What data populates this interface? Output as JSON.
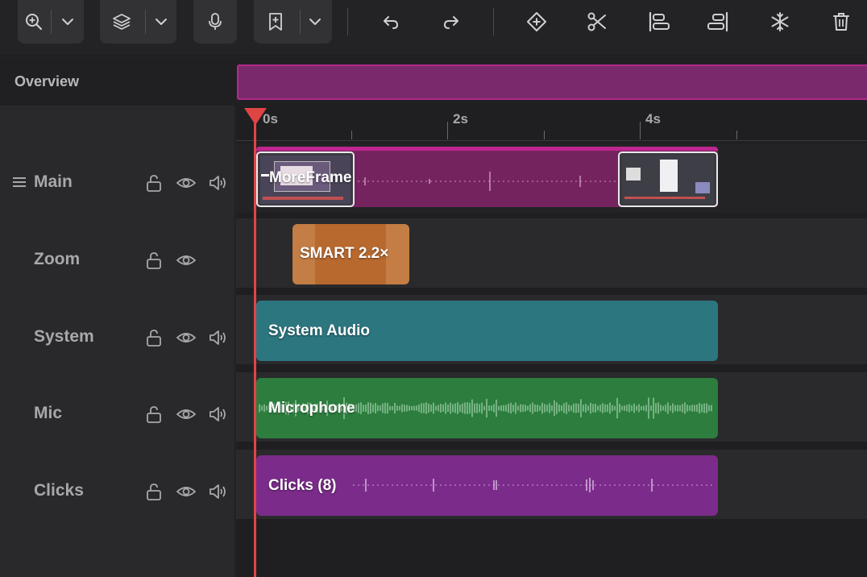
{
  "toolbar": {
    "groups": [
      {
        "name": "zoom-group"
      },
      {
        "name": "layers-group"
      },
      {
        "name": "record-voiceover"
      },
      {
        "name": "bookmark-group"
      }
    ]
  },
  "overview": {
    "label": "Overview"
  },
  "ruler": {
    "labels": [
      "0s",
      "2s",
      "4s"
    ]
  },
  "tracks": [
    {
      "label": "Main"
    },
    {
      "label": "Zoom"
    },
    {
      "label": "System"
    },
    {
      "label": "Mic"
    },
    {
      "label": "Clicks"
    }
  ],
  "clips": {
    "main": "MoreFrame",
    "zoom": "SMART 2.2×",
    "system": "System Audio",
    "mic": "Microphone",
    "clicks": "Clicks (8)"
  },
  "colors": {
    "main_clip": "#75235f",
    "zoom_clip": "#c37d45",
    "system_clip": "#2c7680",
    "mic_clip": "#2c7d3e",
    "clicks_clip": "#7b2c8a",
    "playhead": "#e04545"
  }
}
